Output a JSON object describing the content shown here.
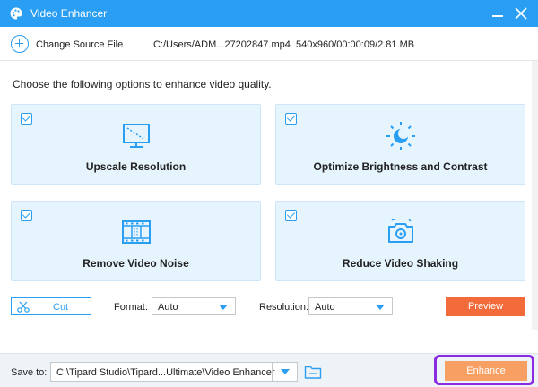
{
  "window": {
    "title": "Video Enhancer"
  },
  "source": {
    "change_label": "Change Source File",
    "file_path": "C:/Users/ADM...27202847.mp4",
    "file_info": "540x960/00:00:09/2.81 MB"
  },
  "instruction": "Choose the following options to enhance video quality.",
  "options": [
    {
      "label": "Upscale Resolution",
      "checked": true,
      "icon": "upscale-monitor-icon"
    },
    {
      "label": "Optimize Brightness and Contrast",
      "checked": true,
      "icon": "brightness-sun-icon"
    },
    {
      "label": "Remove Video Noise",
      "checked": true,
      "icon": "film-strip-icon"
    },
    {
      "label": "Reduce Video Shaking",
      "checked": true,
      "icon": "shaky-camera-icon"
    }
  ],
  "controls": {
    "cut_label": "Cut",
    "format_label": "Format:",
    "format_value": "Auto",
    "resolution_label": "Resolution:",
    "resolution_value": "Auto",
    "preview_label": "Preview"
  },
  "footer": {
    "save_to_label": "Save to:",
    "save_path": "C:\\Tipard Studio\\Tipard...Ultimate\\Video Enhancer",
    "enhance_label": "Enhance"
  },
  "colors": {
    "accent": "#2a9ef2",
    "card_bg": "#e6f4fd",
    "preview": "#f36b3a",
    "enhance": "#f8a064",
    "highlight": "#8a2be2"
  }
}
